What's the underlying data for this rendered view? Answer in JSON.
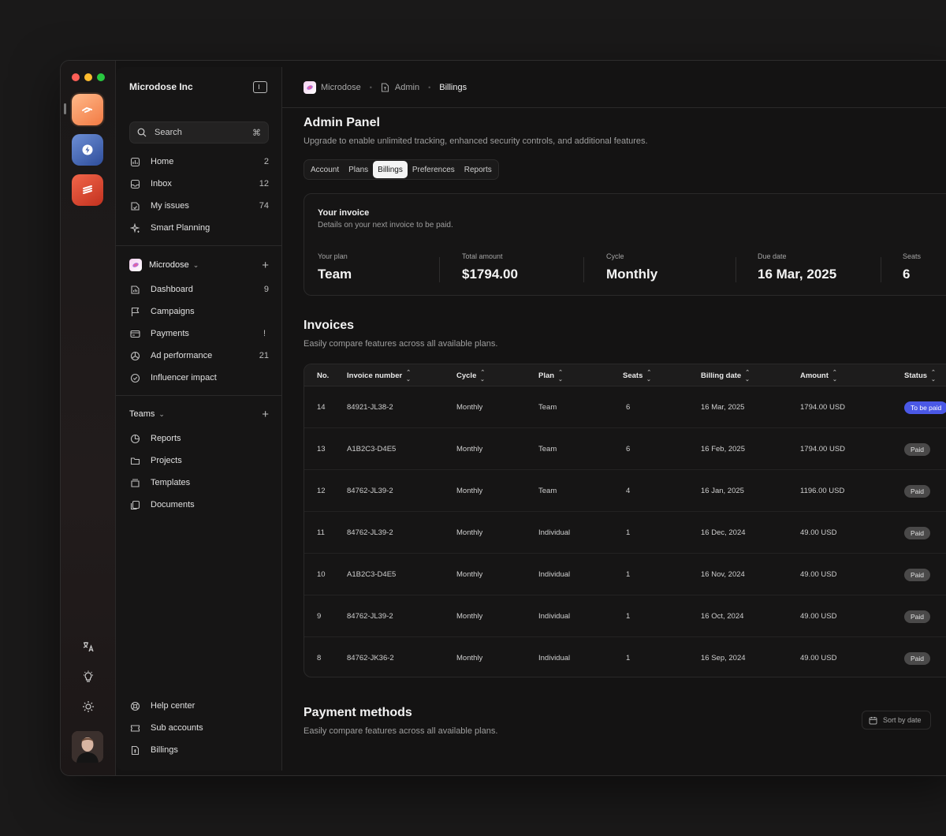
{
  "window": {
    "traffic_lights": [
      "#fe5f57",
      "#febc2e",
      "#28c840"
    ]
  },
  "sidebar": {
    "org_name": "Microdose Inc",
    "search": {
      "label": "Search",
      "shortcut": "⌘"
    },
    "primary_items": [
      {
        "label": "Home",
        "count": "2",
        "icon": "home-icon"
      },
      {
        "label": "Inbox",
        "count": "12",
        "icon": "inbox-icon"
      },
      {
        "label": "My issues",
        "count": "74",
        "icon": "issues-icon"
      },
      {
        "label": "Smart Planning",
        "count": "",
        "icon": "sparkle-icon"
      }
    ],
    "workspace": {
      "name": "Microdose",
      "items": [
        {
          "label": "Dashboard",
          "count": "9",
          "icon": "dashboard-icon"
        },
        {
          "label": "Campaigns",
          "count": "",
          "icon": "flag-icon"
        },
        {
          "label": "Payments",
          "count": "!",
          "icon": "card-icon"
        },
        {
          "label": "Ad performance",
          "count": "21",
          "icon": "ad-icon"
        },
        {
          "label": "Influencer impact",
          "count": "",
          "icon": "check-circle-icon"
        }
      ]
    },
    "teams": {
      "name": "Teams",
      "items": [
        {
          "label": "Reports",
          "icon": "pie-icon"
        },
        {
          "label": "Projects",
          "icon": "folder-icon"
        },
        {
          "label": "Templates",
          "icon": "templates-icon"
        },
        {
          "label": "Documents",
          "icon": "documents-icon"
        }
      ]
    },
    "bottom_items": [
      {
        "label": "Help center",
        "icon": "help-icon"
      },
      {
        "label": "Sub accounts",
        "icon": "ticket-icon"
      },
      {
        "label": "Billings",
        "icon": "billing-icon"
      }
    ]
  },
  "topbar": {
    "crumbs": [
      "Microdose",
      "Admin",
      "Billings"
    ]
  },
  "main": {
    "title": "Admin Panel",
    "subtitle": "Upgrade to enable unlimited tracking, enhanced security controls, and additional features.",
    "tabs": [
      "Account",
      "Plans",
      "Billings",
      "Preferences",
      "Reports"
    ],
    "active_tab": "Billings"
  },
  "invoice_card": {
    "title": "Your invoice",
    "subtitle": "Details on your next invoice to be paid.",
    "stats": [
      {
        "label": "Your plan",
        "value": "Team"
      },
      {
        "label": "Total amount",
        "value": "$1794.00"
      },
      {
        "label": "Cycle",
        "value": "Monthly"
      },
      {
        "label": "Due date",
        "value": "16 Mar, 2025"
      },
      {
        "label": "Seats",
        "value": "6"
      }
    ]
  },
  "invoices": {
    "title": "Invoices",
    "subtitle": "Easily compare features across all available plans.",
    "columns": [
      "No.",
      "Invoice number",
      "Cycle",
      "Plan",
      "Seats",
      "Billing date",
      "Amount",
      "Status"
    ],
    "rows": [
      {
        "no": "14",
        "number": "84921-JL38-2",
        "cycle": "Monthly",
        "plan": "Team",
        "seats": "6",
        "date": "16 Mar, 2025",
        "amount": "1794.00 USD",
        "status": "To be paid"
      },
      {
        "no": "13",
        "number": "A1B2C3-D4E5",
        "cycle": "Monthly",
        "plan": "Team",
        "seats": "6",
        "date": "16 Feb, 2025",
        "amount": "1794.00 USD",
        "status": "Paid"
      },
      {
        "no": "12",
        "number": "84762-JL39-2",
        "cycle": "Monthly",
        "plan": "Team",
        "seats": "4",
        "date": "16 Jan, 2025",
        "amount": "1196.00 USD",
        "status": "Paid"
      },
      {
        "no": "11",
        "number": "84762-JL39-2",
        "cycle": "Monthly",
        "plan": "Individual",
        "seats": "1",
        "date": "16 Dec, 2024",
        "amount": "49.00 USD",
        "status": "Paid"
      },
      {
        "no": "10",
        "number": "A1B2C3-D4E5",
        "cycle": "Monthly",
        "plan": "Individual",
        "seats": "1",
        "date": "16 Nov, 2024",
        "amount": "49.00 USD",
        "status": "Paid"
      },
      {
        "no": "9",
        "number": "84762-JL39-2",
        "cycle": "Monthly",
        "plan": "Individual",
        "seats": "1",
        "date": "16 Oct, 2024",
        "amount": "49.00 USD",
        "status": "Paid"
      },
      {
        "no": "8",
        "number": "84762-JK36-2",
        "cycle": "Monthly",
        "plan": "Individual",
        "seats": "1",
        "date": "16 Sep, 2024",
        "amount": "49.00 USD",
        "status": "Paid"
      }
    ]
  },
  "payment_methods": {
    "title": "Payment methods",
    "subtitle": "Easily compare features across all available plans.",
    "sort_label": "Sort by date"
  },
  "colors": {
    "accent_due": "#4a58e6",
    "paid_badge": "#4a4949"
  }
}
